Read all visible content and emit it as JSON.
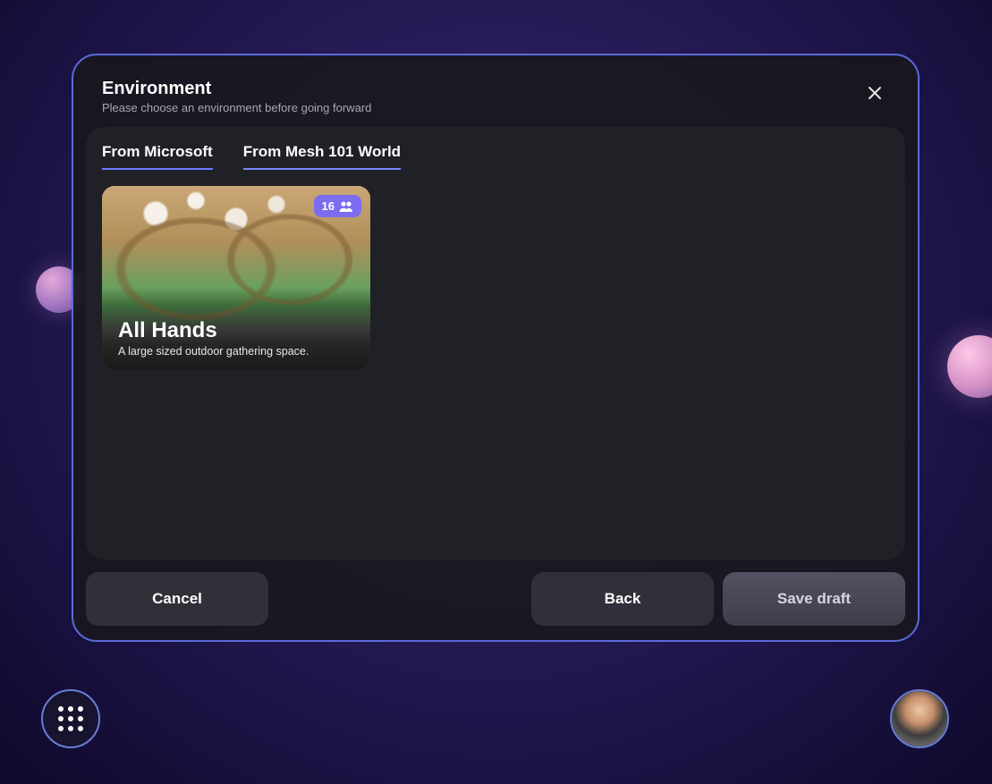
{
  "dialog": {
    "title": "Environment",
    "subtitle": "Please choose an environment before going forward"
  },
  "tabs": [
    {
      "label": "From Microsoft"
    },
    {
      "label": "From Mesh 101 World"
    }
  ],
  "card": {
    "title": "All Hands",
    "description": "A large sized outdoor gathering space.",
    "capacity": "16"
  },
  "buttons": {
    "cancel": "Cancel",
    "back": "Back",
    "save": "Save draft"
  }
}
